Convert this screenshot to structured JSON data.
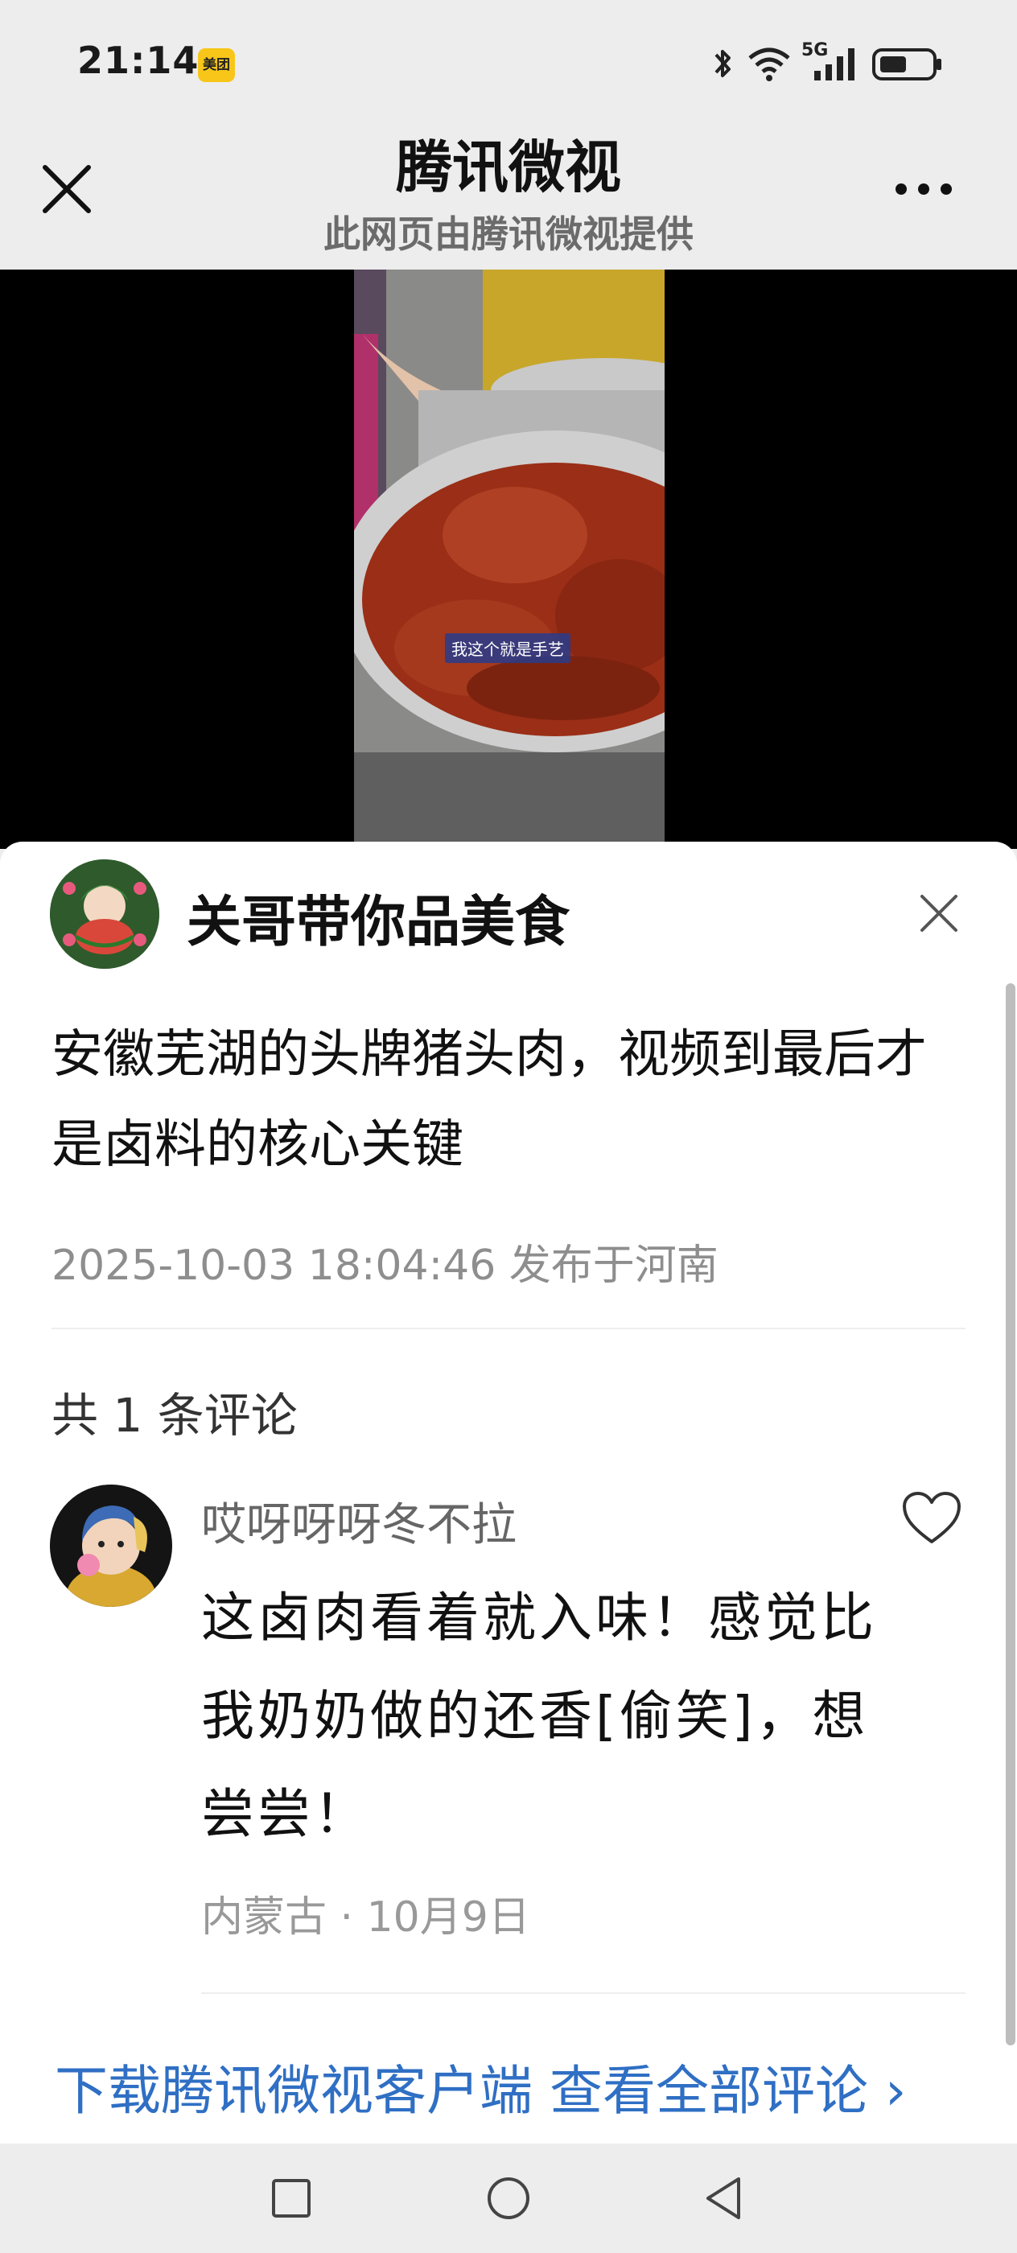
{
  "status_bar": {
    "time": "21:14",
    "app_badge": "美团",
    "network": "5G",
    "icons": [
      "bluetooth-icon",
      "wifi-icon",
      "signal-icon",
      "battery-icon"
    ]
  },
  "header": {
    "title": "腾讯微视",
    "subtitle": "此网页由腾讯微视提供"
  },
  "video": {
    "caption": "我这个就是手艺"
  },
  "post": {
    "author": "关哥带你品美食",
    "title": "安徽芜湖的头牌猪头肉，视频到最后才是卤料的核心关键",
    "meta": "2025-10-03 18:04:46 发布于河南"
  },
  "comments": {
    "count_text": "共 1 条评论",
    "items": [
      {
        "name": "哎呀呀呀冬不拉",
        "text": "这卤肉看着就入味！感觉比我奶奶做的还香[偷笑]，想尝尝！",
        "meta": "内蒙古 · 10月9日"
      }
    ]
  },
  "download": {
    "label": "下载腾讯微视客户端 查看全部评论 ›"
  },
  "colors": {
    "link": "#2f6fc4",
    "background": "#ededed",
    "badge": "#f7c619"
  }
}
